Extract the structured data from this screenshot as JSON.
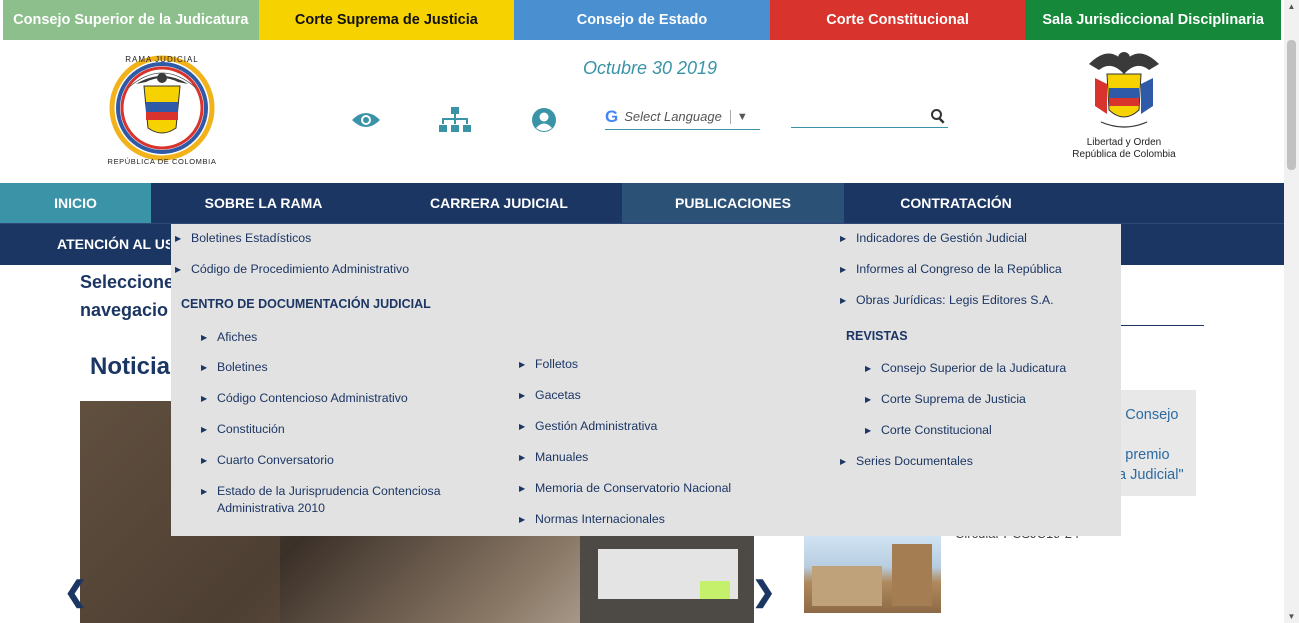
{
  "topbar": [
    {
      "label": "Consejo Superior de la Judicatura",
      "bg": "#8cbf8c",
      "dark": false
    },
    {
      "label": "Corte Suprema de Justicia",
      "bg": "#f6d200",
      "dark": true
    },
    {
      "label": "Consejo de Estado",
      "bg": "#4a8fd0",
      "dark": false
    },
    {
      "label": "Corte Constitucional",
      "bg": "#d8332c",
      "dark": false
    },
    {
      "label": "Sala Jurisdiccional Disciplinaria",
      "bg": "#15883a",
      "dark": false
    }
  ],
  "header": {
    "date": "Octubre 30 2019",
    "logo_left_text": "RAMA JUDICIAL · REPÚBLICA DE COLOMBIA",
    "logo_right_line1": "Libertad y Orden",
    "logo_right_line2": "República de Colombia",
    "language": {
      "g": "G",
      "label": "Select Language",
      "arrow": "▼"
    },
    "search_placeholder": "",
    "icons": [
      "eye-icon",
      "sitemap-icon",
      "user-icon",
      "search-icon"
    ]
  },
  "nav": {
    "inicio": "INICIO",
    "sobre": "SOBRE LA RAMA",
    "carrera": "CARRERA JUDICIAL",
    "publicaciones": "PUBLICACIONES",
    "contratacion": "CONTRATACIÓN",
    "atencion": "ATENCIÓN AL USUARIO"
  },
  "content": {
    "select_line1": "Seleccione",
    "select_line2": "navegacio",
    "noticias": "Noticias",
    "news_line1": "l Consejo",
    "news_line2": "l premio",
    "news_line3": "a Judicial\"",
    "circular": "Circular PCSJC19-24",
    "prev": "❮",
    "next": "❯"
  },
  "dropdown": {
    "col1_top": [
      "Boletines Estadísticos",
      "Código de Procedimiento Administrativo"
    ],
    "centro_heading": "CENTRO DE DOCUMENTACIÓN JUDICIAL",
    "centro_col1": [
      "Afiches",
      "Boletines",
      "Código Contencioso Administrativo",
      "Constitución",
      "Cuarto Conversatorio"
    ],
    "centro_col1_last_line1": "Estado de la Jurisprudencia Contenciosa",
    "centro_col1_last_line2": "Administrativa 2010",
    "centro_col2": [
      "Folletos",
      "Gacetas",
      "Gestión Administrativa",
      "Manuales",
      "Memoria de Conservatorio Nacional",
      "Normas Internacionales"
    ],
    "col3_top": [
      "Indicadores de Gestión Judicial",
      "Informes al Congreso de la República",
      "Obras Jurídicas: Legis Editores S.A."
    ],
    "revistas_heading": "REVISTAS",
    "revistas": [
      "Consejo Superior de la Judicatura",
      "Corte Suprema de Justicia",
      "Corte Constitucional"
    ],
    "series": "Series Documentales",
    "bullet": "▶"
  },
  "colors": {
    "navy": "#1c3664",
    "teal": "#3a93a6",
    "active_nav": "#2c5177",
    "dropdown_bg": "#e2e2e2"
  }
}
